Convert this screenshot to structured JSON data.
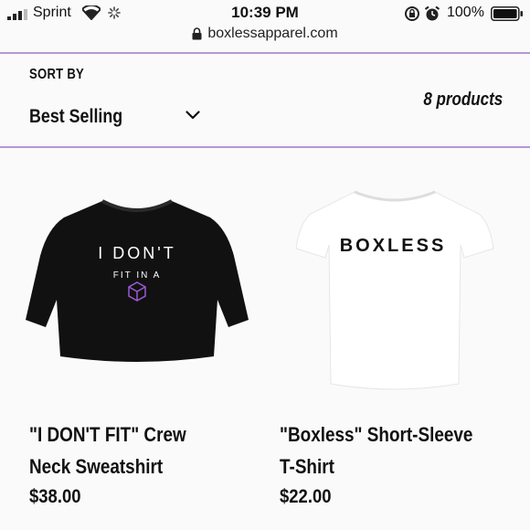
{
  "status_bar": {
    "carrier": "Sprint",
    "time": "10:39 PM",
    "battery": "100%"
  },
  "browser": {
    "url": "boxlessapparel.com"
  },
  "sort": {
    "label": "SORT BY",
    "value": "Best Selling"
  },
  "products_count": "8 products",
  "products": [
    {
      "title": "\"I DON'T FIT\" Crew Neck Sweatshirt",
      "price": "$38.00",
      "print_line1": "I DON'T",
      "print_line2": "FIT IN A"
    },
    {
      "title": "\"Boxless\" Short-Sleeve T-Shirt",
      "price": "$22.00",
      "print_line1": "BOXLESS"
    }
  ],
  "colors": {
    "accent_line": "#b795d6",
    "sweatshirt": "#111111",
    "tshirt": "#ffffff",
    "cube": "#9b59d6"
  }
}
